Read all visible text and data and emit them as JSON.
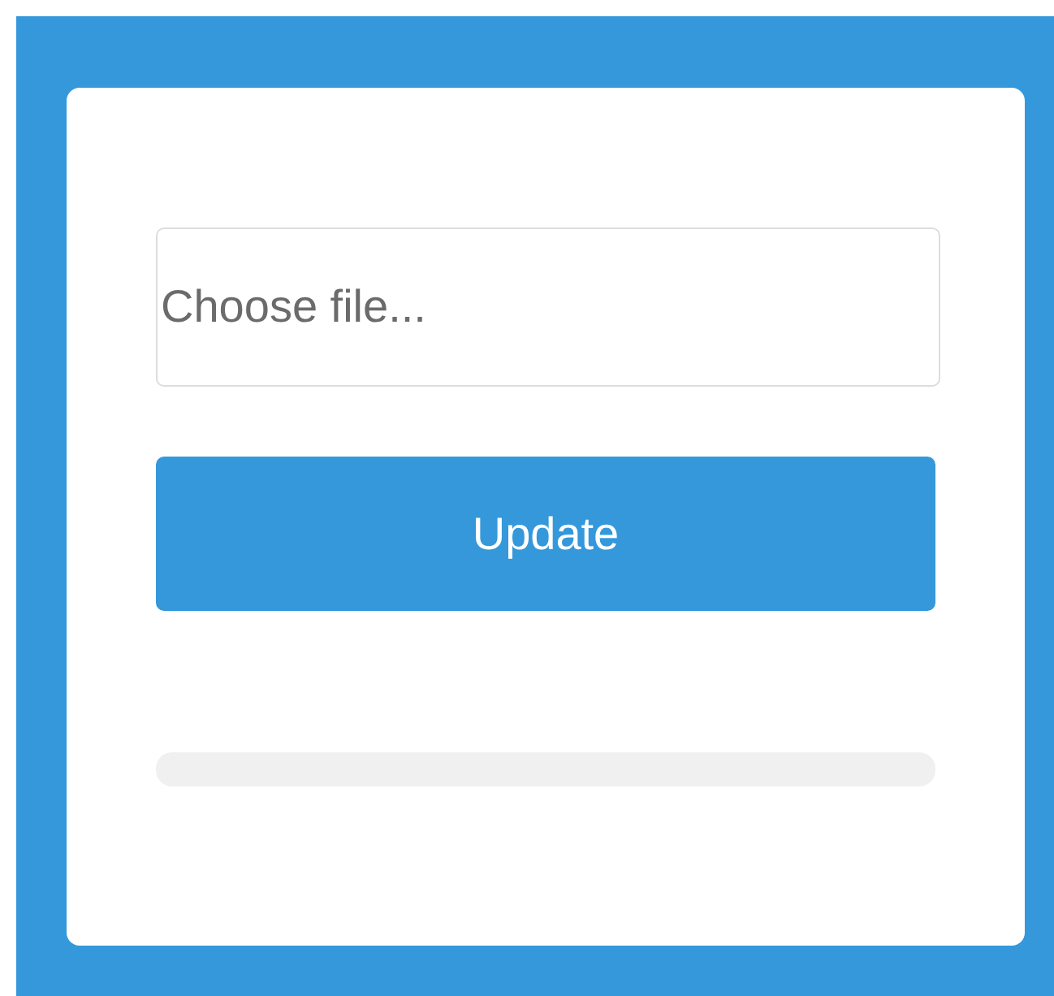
{
  "file_field": {
    "placeholder": "Choose file..."
  },
  "button": {
    "label": "Update"
  },
  "progress": {
    "level": 0
  }
}
